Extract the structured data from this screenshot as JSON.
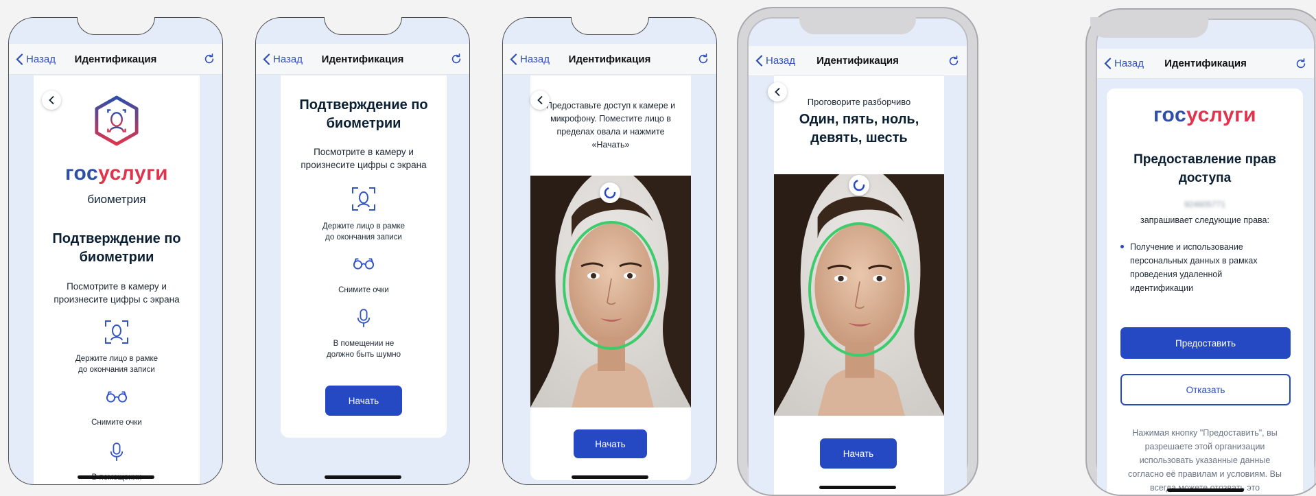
{
  "nav": {
    "back_label": "Назад",
    "title": "Идентификация"
  },
  "screen1": {
    "brand_a": "гос",
    "brand_b": "услуги",
    "subtitle": "биометрия",
    "heading": "Подтверждение по биометрии",
    "description": "Посмотрите в камеру и произнесите цифры с экрана",
    "tip1": "Держите лицо в рамке до окончания записи",
    "tip2": "Снимите очки",
    "tip3": "В помещении"
  },
  "screen2": {
    "heading": "Подтверждение по биометрии",
    "description": "Посмотрите в камеру и произнесите цифры с экрана",
    "tip1": "Держите лицо в рамке до окончания записи",
    "tip2": "Снимите очки",
    "tip3": "В помещении не должно быть шумно",
    "start_label": "Начать"
  },
  "screen3": {
    "instruction": "Предоставьте доступ к камере и микрофону. Поместите лицо в пределах овала и нажмите «Начать»",
    "start_label": "Начать"
  },
  "screen4": {
    "prompt": "Проговорите разборчиво",
    "digits": "Один, пять, ноль, девять, шесть",
    "start_label": "Начать"
  },
  "screen5": {
    "brand_a": "гос",
    "brand_b": "услуги",
    "heading": "Предоставление прав доступа",
    "org_id": "924605771",
    "request_text": "запрашивает следующие права:",
    "permission": "Получение и использование персональных данных в рамках проведения удаленной идентификации",
    "grant_label": "Предоставить",
    "deny_label": "Отказать",
    "footer": "Нажимая кнопку \"Предоставить\", вы разрешаете этой организации использовать указанные данные согласно её правилам и условиям. Вы всегда можете отозвать это"
  },
  "colors": {
    "accent": "#2549c2",
    "brand_blue": "#2d4fa8",
    "brand_red": "#e0344d",
    "oval": "#3ecb6b",
    "bg": "#e4ebf9"
  }
}
